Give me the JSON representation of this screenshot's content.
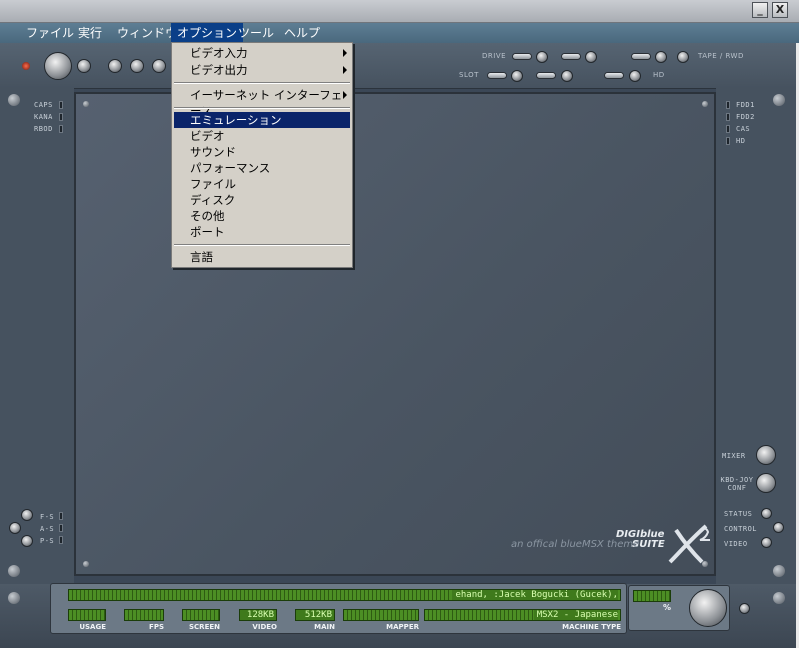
{
  "menubar": {
    "items": [
      {
        "label": "ファイル"
      },
      {
        "label": "実行"
      },
      {
        "label": "ウィンドウ"
      },
      {
        "label": "オプション"
      },
      {
        "label": "ツール"
      },
      {
        "label": "ヘルプ"
      }
    ]
  },
  "options_menu": {
    "items": [
      {
        "label": "ビデオ入力",
        "submenu": true
      },
      {
        "label": "ビデオ出力",
        "submenu": true
      },
      {
        "label": "イーサーネット インターフェース",
        "submenu": true
      },
      {
        "label": "エミュレーション",
        "highlighted": true
      },
      {
        "label": "ビデオ"
      },
      {
        "label": "サウンド"
      },
      {
        "label": "パフォーマンス"
      },
      {
        "label": "ファイル"
      },
      {
        "label": "ディスク"
      },
      {
        "label": "その他"
      },
      {
        "label": "ポート"
      },
      {
        "label": "言語"
      }
    ]
  },
  "top_strip": {
    "drive_label": "DRIVE",
    "slot_label": "SLOT",
    "tape_label": "TAPE / RWD",
    "hd_label": "HD"
  },
  "left_indicators": [
    "CAPS",
    "KANA",
    "RBOD"
  ],
  "right_indicators": [
    "FDD1",
    "FDD2",
    "CAS",
    "HD"
  ],
  "left_bottom_indicators": [
    "F-S",
    "A-S",
    "P-S"
  ],
  "right_bottom_controls": [
    "MIXER",
    "KBD-JOY CONF",
    "STATUS",
    "CONTROL",
    "VIDEO"
  ],
  "branding": {
    "line1": "DIGIblue",
    "line2": "SUITE",
    "tagline": "an offical blueMSX theme"
  },
  "status": {
    "marquee": "ehand, :Jacek Bogucki (Gucek),",
    "video": "128KB",
    "main": "512KB",
    "machine": "MSX2 - Japanese",
    "labels": {
      "usage": "USAGE",
      "fps": "FPS",
      "screen": "SCREEN",
      "video": "VIDEO",
      "main": "MAIN",
      "mapper": "MAPPER",
      "machine_type": "MACHINE TYPE"
    },
    "percent_symbol": "%"
  },
  "window_buttons": {
    "minimize": "_",
    "close": "X"
  },
  "colors": {
    "menu_highlight": "#0a246a",
    "lcd": "#3f7a1c",
    "lcd_text": "#d8ffb0"
  }
}
